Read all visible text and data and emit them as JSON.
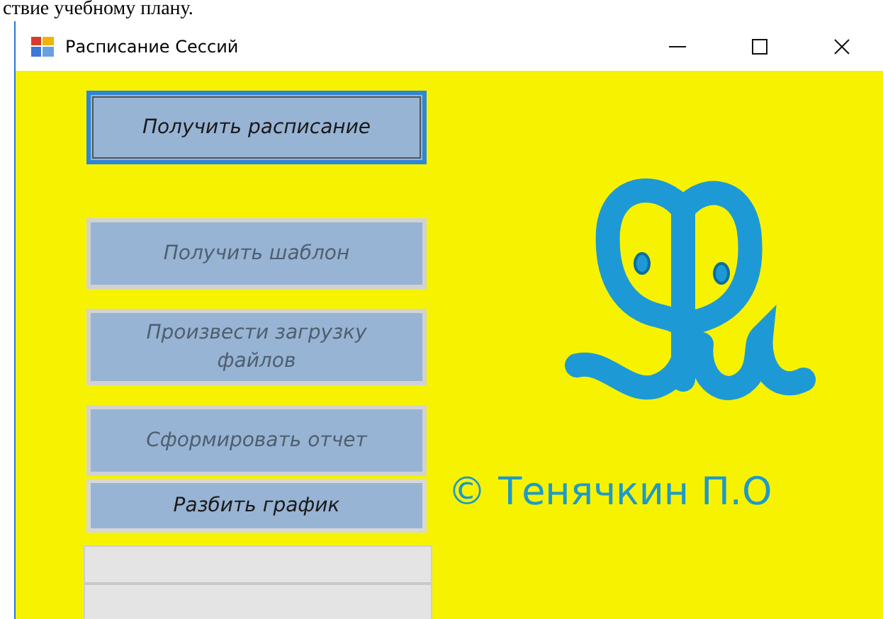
{
  "document_text": "ствие учебному плану.",
  "window": {
    "title": "Расписание Сессий"
  },
  "buttons": [
    {
      "label": "Получить расписание",
      "focused": true,
      "disabled": false
    },
    {
      "label": "Получить шаблон",
      "focused": false,
      "disabled": true
    },
    {
      "label": "Произвести загрузку файлов",
      "focused": false,
      "disabled": true
    },
    {
      "label": "Сформировать отчет",
      "focused": false,
      "disabled": true
    },
    {
      "label": "Разбить график",
      "focused": false,
      "disabled": false
    }
  ],
  "copyright": "© Тенячкин П.О"
}
